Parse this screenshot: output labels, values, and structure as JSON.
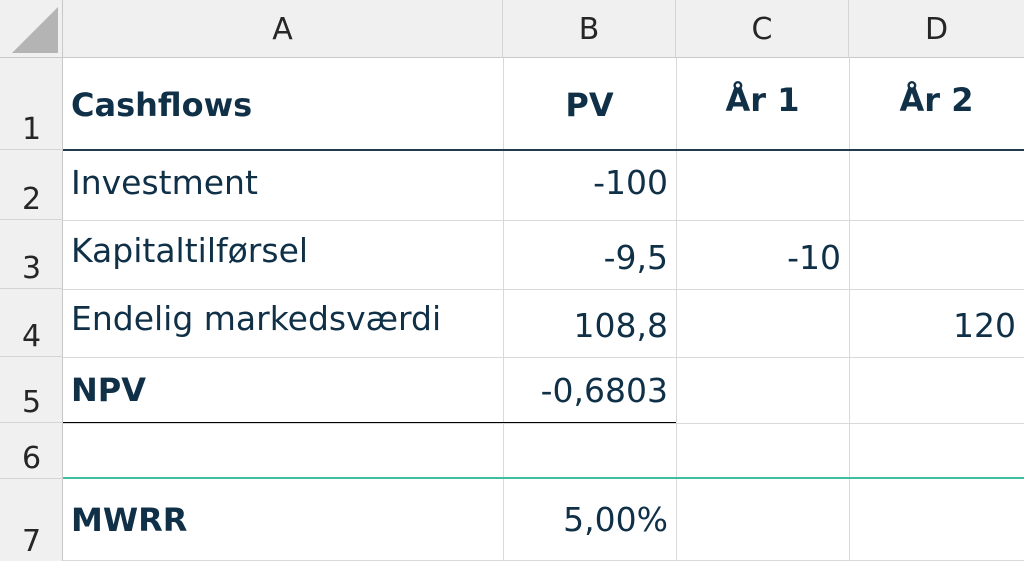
{
  "columns": [
    "A",
    "B",
    "C",
    "D"
  ],
  "rows": [
    "1",
    "2",
    "3",
    "4",
    "5",
    "6",
    "7"
  ],
  "cells": {
    "A1": "Cashflows",
    "B1": "PV",
    "C1": "År 1",
    "D1": "År 2",
    "A2": "Investment",
    "B2": "-100",
    "A3": "Kapitaltilførsel",
    "B3": "-9,5",
    "C3": "-10",
    "A4": "Endelig markedsværdi",
    "B4": "108,8",
    "D4": "120",
    "A5": "NPV",
    "B5": "-0,6803",
    "A7": "MWRR",
    "B7": "5,00%"
  },
  "colors": {
    "text": "#0f3047",
    "header_border": "#1f3b4d",
    "accent_border": "#3fbfa2",
    "header_bg": "#f0f0f0"
  }
}
